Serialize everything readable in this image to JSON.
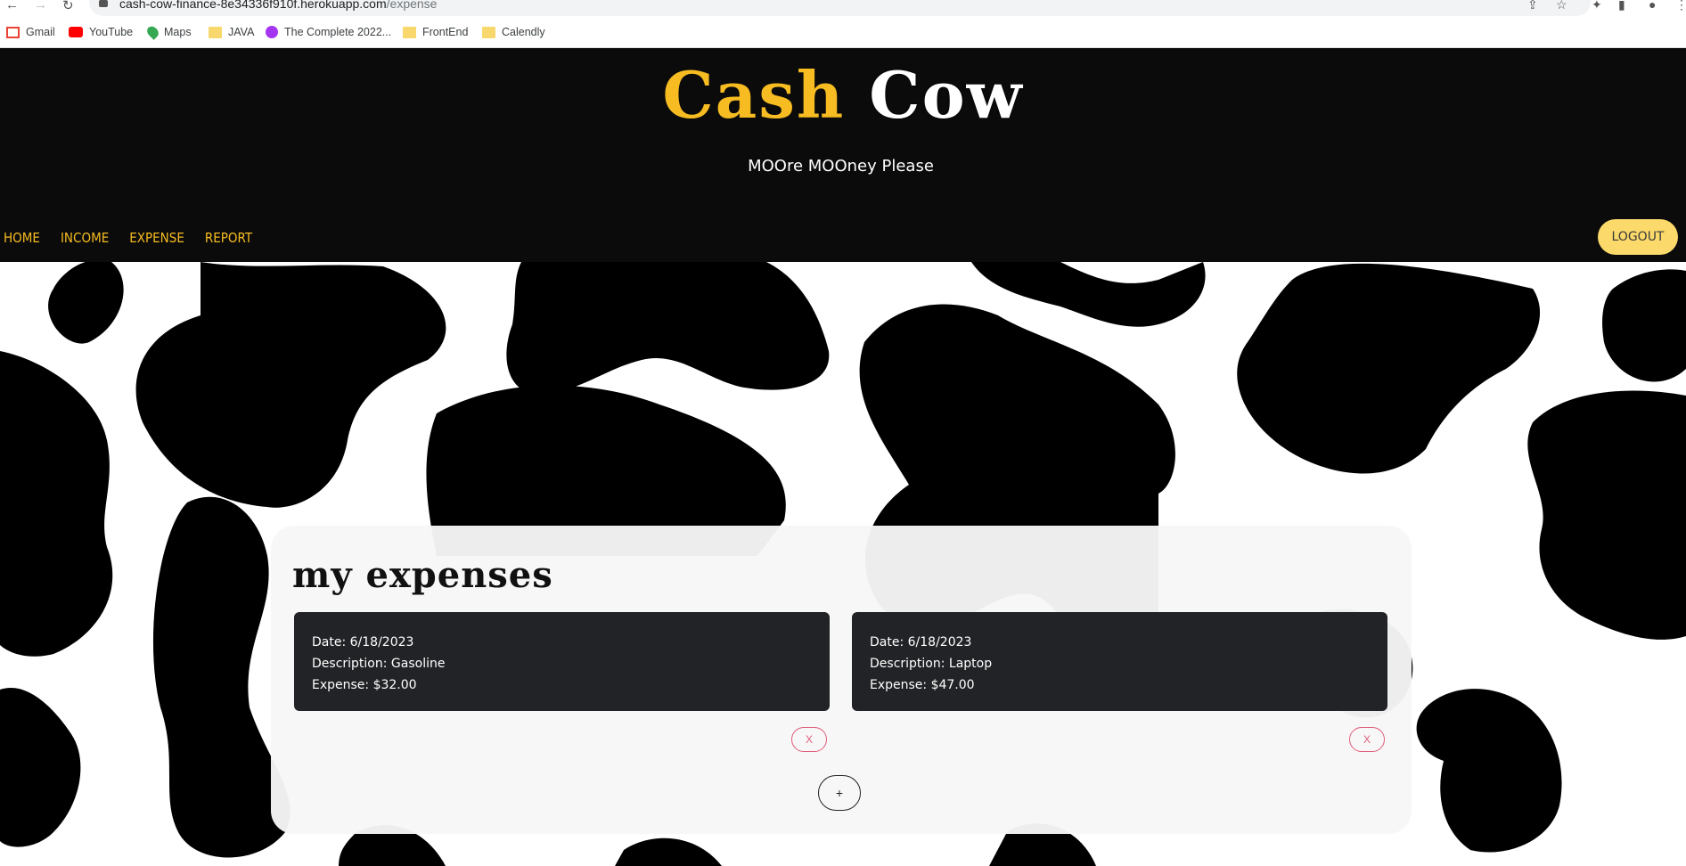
{
  "browser": {
    "url_host": "cash-cow-finance-8e34336f910f.herokuapp.com",
    "url_path": "/expense",
    "bookmarks": [
      {
        "label": "Gmail",
        "icon": "gmail-icon"
      },
      {
        "label": "YouTube",
        "icon": "youtube-icon"
      },
      {
        "label": "Maps",
        "icon": "maps-icon"
      },
      {
        "label": "JAVA",
        "icon": "folder-icon"
      },
      {
        "label": "The Complete 2022...",
        "icon": "course-icon"
      },
      {
        "label": "FrontEnd",
        "icon": "folder-icon"
      },
      {
        "label": "Calendly",
        "icon": "folder-icon"
      }
    ]
  },
  "header": {
    "logo_part1": "Cash",
    "logo_part2": "Cow",
    "tagline": "MOOre MOOney Please",
    "nav": [
      "HOME",
      "INCOME",
      "EXPENSE",
      "REPORT"
    ],
    "logout_label": "LOGOUT"
  },
  "main": {
    "title": "my expenses",
    "expenses": [
      {
        "date": "Date: 6/18/2023",
        "description": "Description: Gasoline",
        "expense": "Expense: $32.00",
        "delete_label": "X"
      },
      {
        "date": "Date: 6/18/2023",
        "description": "Description: Laptop",
        "expense": "Expense: $47.00",
        "delete_label": "X"
      }
    ],
    "add_label": "+"
  },
  "colors": {
    "header_bg": "#0b0b0b",
    "accent_yellow": "#f7bc21",
    "logout_bg": "#fbd96a",
    "card_bg": "#222326",
    "delete_pink": "#e05d7a"
  }
}
